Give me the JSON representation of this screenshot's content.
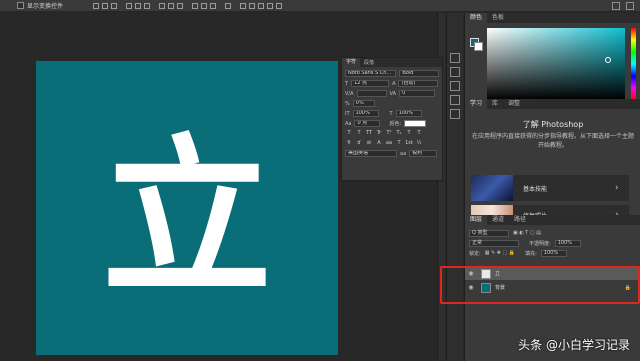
{
  "options_bar": {
    "checkbox_label": "显示变换控件",
    "colors": {
      "bar": "#3a3a3a"
    }
  },
  "canvas": {
    "fill": "#0a6e78",
    "text": "立"
  },
  "character_panel": {
    "tabs": [
      "字符",
      "段落"
    ],
    "font_family": "Noto Sans S Ch...",
    "font_style": "Bold",
    "size": "12 点",
    "leading": "(自动)",
    "kerning_label": "V/A",
    "tracking": "0",
    "scale_pct": "0%",
    "vscale": "100%",
    "hscale": "100%",
    "baseline": "0 点",
    "color_label": "颜色:",
    "style_buttons": [
      "T",
      "T",
      "TT",
      "Tr",
      "T¹",
      "T₁",
      "T",
      "T"
    ],
    "lang": "美国英语",
    "aa": "锐利"
  },
  "color_panel": {
    "tabs": [
      "颜色",
      "色板"
    ],
    "foreground": "#0a6e78",
    "background": "#ffffff"
  },
  "learn_panel": {
    "tabs": [
      "学习",
      "库",
      "调整"
    ],
    "title": "了解 Photoshop",
    "desc": "在应用程序内直接获得的分步指导教程。从下面选择一个主题开始教程。",
    "cards": [
      {
        "label": "基本技能"
      },
      {
        "label": "修复照片"
      }
    ]
  },
  "layers_panel": {
    "tabs": [
      "图层",
      "通道",
      "路径"
    ],
    "filter_label": "Q 类型",
    "blend_mode": "正常",
    "opacity_label": "不透明度:",
    "opacity": "100%",
    "lock_label": "锁定:",
    "fill_label": "填充:",
    "fill": "100%",
    "layers": [
      {
        "name": "立",
        "selected": true
      },
      {
        "name": "背景",
        "selected": false
      }
    ]
  },
  "watermark": "头条 @小白学习记录"
}
